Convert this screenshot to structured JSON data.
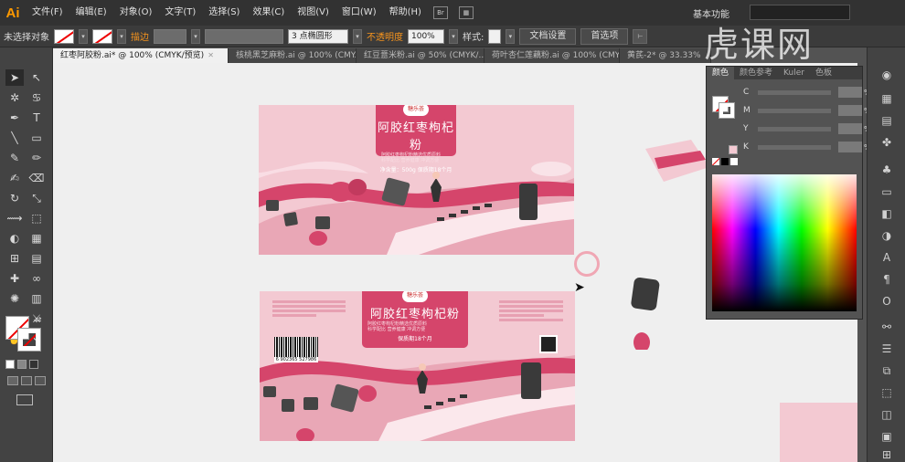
{
  "app": {
    "logo": "Ai"
  },
  "menu": [
    "文件(F)",
    "编辑(E)",
    "对象(O)",
    "文字(T)",
    "选择(S)",
    "效果(C)",
    "视图(V)",
    "窗口(W)",
    "帮助(H)"
  ],
  "menu_icon": "Br",
  "workspace": "基本功能",
  "control": {
    "selection": "未选择对象",
    "stroke_label": "描边",
    "brush_value": "3 点椭圆形",
    "opacity_label": "不透明度",
    "opacity_value": "100%",
    "style_label": "样式:",
    "doc_settings": "文档设置",
    "prefs": "首选项"
  },
  "tabs": [
    {
      "label": "红枣阿胶粉.ai* @ 100% (CMYK/预览)",
      "active": true
    },
    {
      "label": "核桃黑芝麻粉.ai @ 100% (CMY...",
      "active": false
    },
    {
      "label": "红豆薏米粉.ai @ 50% (CMYK/...",
      "active": false
    },
    {
      "label": "荷叶杏仁莲藕粉.ai @ 100% (CMY...",
      "active": false
    },
    {
      "label": "黄芪-2* @ 33.33%",
      "active": false
    }
  ],
  "package": {
    "brand": "糖乐荟",
    "title": "阿胶红枣枸杞粉",
    "net": "净含量：500g 保质期18个月",
    "desc_lines": [
      "阿胶红枣枸杞粉精选优质原料",
      "科学配比 营养健康 冲调方便",
      "口感细腻 滋补养颜"
    ],
    "barcode_number": "6 902365 527986",
    "bottom_desc_lines": [
      "阿胶红枣枸杞粉精选优质原料",
      "科学配比 营养健康 冲调方便"
    ],
    "bottom_net": "保质期18个月"
  },
  "color_panel": {
    "tabs": [
      "颜色",
      "颜色参考",
      "Kuler",
      "色板"
    ],
    "channels": [
      "C",
      "M",
      "Y",
      "K"
    ],
    "pct": "%"
  },
  "watermark": "虎课网",
  "colors": {
    "accent": "#d5456b",
    "pink": "#f3c9d2",
    "canvas": "#efefef"
  }
}
